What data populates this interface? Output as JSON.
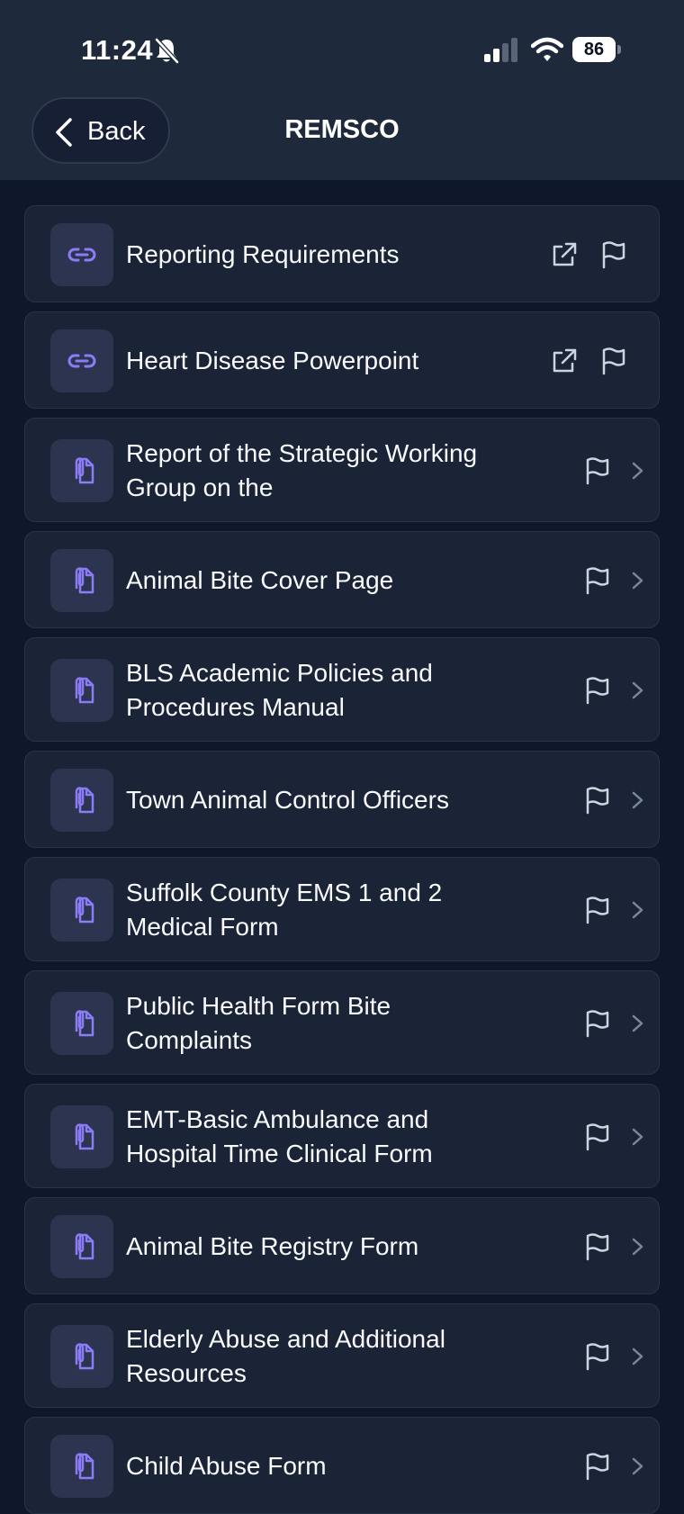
{
  "status_bar": {
    "time": "11:24",
    "battery": "86",
    "icons": [
      "bell-slash-icon",
      "signal-icon",
      "wifi-icon",
      "battery-icon"
    ]
  },
  "nav": {
    "back_label": "Back",
    "title": "REMSCO"
  },
  "items": [
    {
      "label": "Reporting Requirements",
      "type": "link"
    },
    {
      "label": "Heart Disease Powerpoint",
      "type": "link"
    },
    {
      "label": "Report of the Strategic Working Group on the",
      "type": "document"
    },
    {
      "label": "Animal Bite Cover Page",
      "type": "document"
    },
    {
      "label": "BLS Academic Policies and Procedures Manual",
      "type": "document"
    },
    {
      "label": "Town Animal Control Officers",
      "type": "document"
    },
    {
      "label": "Suffolk County EMS 1 and 2 Medical Form",
      "type": "document"
    },
    {
      "label": "Public Health Form Bite Complaints",
      "type": "document"
    },
    {
      "label": "EMT-Basic Ambulance and Hospital Time Clinical Form",
      "type": "document"
    },
    {
      "label": "Animal Bite Registry Form",
      "type": "document"
    },
    {
      "label": "Elderly Abuse and Additional Resources",
      "type": "document"
    },
    {
      "label": "Child Abuse Form",
      "type": "document"
    }
  ],
  "colors": {
    "background": "#0f172a",
    "card": "#1b2436",
    "icon_tile": "#2c3450",
    "accent": "#8b7cf6"
  }
}
